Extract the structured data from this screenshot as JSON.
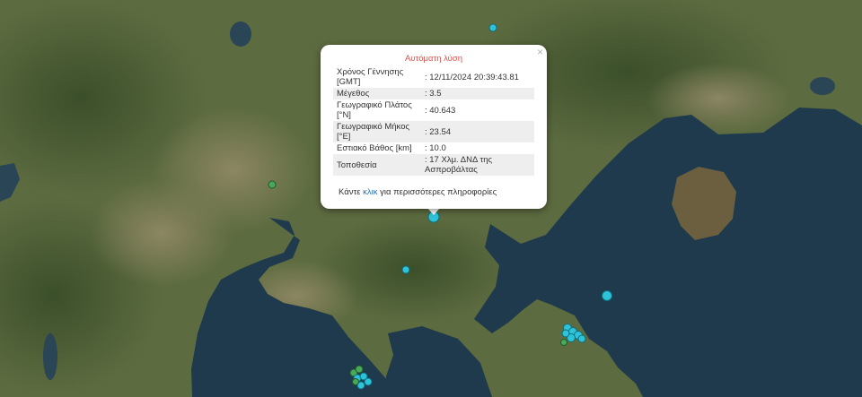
{
  "popup": {
    "title": "Αυτόματη λύση",
    "close_symbol": "×",
    "rows": [
      {
        "label": "Χρόνος Γέννησης [GMT]",
        "value": ": 12/11/2024 20:39:43.81"
      },
      {
        "label": "Μέγεθος",
        "value": ": 3.5"
      },
      {
        "label": "Γεωγραφικό Πλάτος [°N]",
        "value": ": 40.643"
      },
      {
        "label": "Γεωγραφικό Μήκος [°E]",
        "value": ": 23.54"
      },
      {
        "label": "Εστιακό Βάθος [km]",
        "value": ": 10.0"
      },
      {
        "label": "Τοποθεσία",
        "value": ": 17 Χλμ. ΔΝΔ της Ασπροβάλτας"
      }
    ],
    "more_prefix": "Κάντε ",
    "more_link": "κλικ",
    "more_suffix": " για περισσότερες πληροφορίες"
  },
  "colors": {
    "quake_cyan": "#2fc3d9",
    "quake_green": "#4aa85a",
    "sea": "#1e3a4c",
    "land": "#5b6a3e",
    "error_red": "#d9534f",
    "link_blue": "#2a6fb0"
  }
}
